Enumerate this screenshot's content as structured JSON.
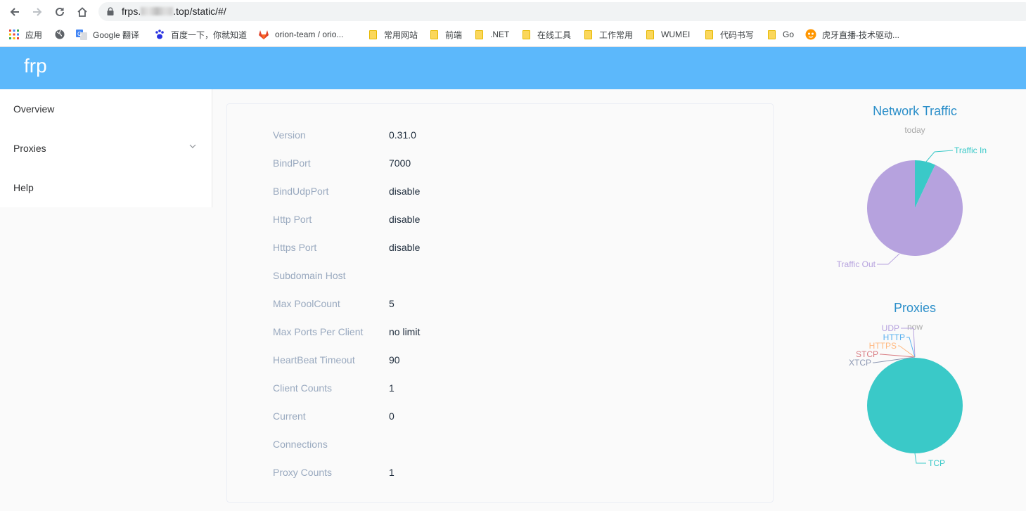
{
  "browser": {
    "url_prefix": "frps.",
    "url_suffix": ".top/static/#/",
    "bookmarks": [
      {
        "label": "应用",
        "icon": "apps-grid-icon"
      },
      {
        "label": "",
        "icon": "globe-icon"
      },
      {
        "label": "Google 翻译",
        "icon": "google-translate-icon"
      },
      {
        "label": "百度一下，你就知道",
        "icon": "baidu-paw-icon"
      },
      {
        "label": "orion-team / orio...",
        "icon": "gitlab-icon"
      },
      {
        "label": "常用网站",
        "icon": "folder-icon"
      },
      {
        "label": "前端",
        "icon": "folder-icon"
      },
      {
        "label": ".NET",
        "icon": "folder-icon"
      },
      {
        "label": "在线工具",
        "icon": "folder-icon"
      },
      {
        "label": "工作常用",
        "icon": "folder-icon"
      },
      {
        "label": "WUMEI",
        "icon": "folder-icon"
      },
      {
        "label": "代码书写",
        "icon": "folder-icon"
      },
      {
        "label": "Go",
        "icon": "folder-icon"
      },
      {
        "label": "虎牙直播-技术驱动...",
        "icon": "huya-icon"
      }
    ]
  },
  "header": {
    "brand": "frp",
    "color": "#5cb8fb"
  },
  "sidebar": {
    "items": [
      {
        "label": "Overview"
      },
      {
        "label": "Proxies",
        "has_submenu": true
      },
      {
        "label": "Help"
      }
    ]
  },
  "server_info": [
    {
      "key": "Version",
      "value": "0.31.0"
    },
    {
      "key": "BindPort",
      "value": "7000"
    },
    {
      "key": "BindUdpPort",
      "value": "disable"
    },
    {
      "key": "Http Port",
      "value": "disable"
    },
    {
      "key": "Https Port",
      "value": "disable"
    },
    {
      "key": "Subdomain Host",
      "value": ""
    },
    {
      "key": "Max PoolCount",
      "value": "5"
    },
    {
      "key": "Max Ports Per Client",
      "value": "no limit"
    },
    {
      "key": "HeartBeat Timeout",
      "value": "90"
    },
    {
      "key": "Client Counts",
      "value": "1"
    },
    {
      "key": "Current",
      "value": "0"
    },
    {
      "key": "Connections",
      "value": ""
    },
    {
      "key": "Proxy Counts",
      "value": "1"
    }
  ],
  "charts": {
    "traffic": {
      "title": "Network Traffic",
      "subtitle": "today",
      "slices": [
        {
          "label": "Traffic In",
          "value": 7,
          "color": "#3ac9c8"
        },
        {
          "label": "Traffic Out",
          "value": 93,
          "color": "#b6a2de"
        }
      ]
    },
    "proxies": {
      "title": "Proxies",
      "subtitle": "now",
      "slices": [
        {
          "label": "TCP",
          "value": 1,
          "color": "#3ac9c8"
        },
        {
          "label": "UDP",
          "value": 0,
          "color": "#b6a2de"
        },
        {
          "label": "HTTP",
          "value": 0,
          "color": "#5ab1ef"
        },
        {
          "label": "HTTPS",
          "value": 0,
          "color": "#ffb980"
        },
        {
          "label": "STCP",
          "value": 0,
          "color": "#d87a80"
        },
        {
          "label": "XTCP",
          "value": 0,
          "color": "#8d98b3"
        }
      ]
    }
  }
}
